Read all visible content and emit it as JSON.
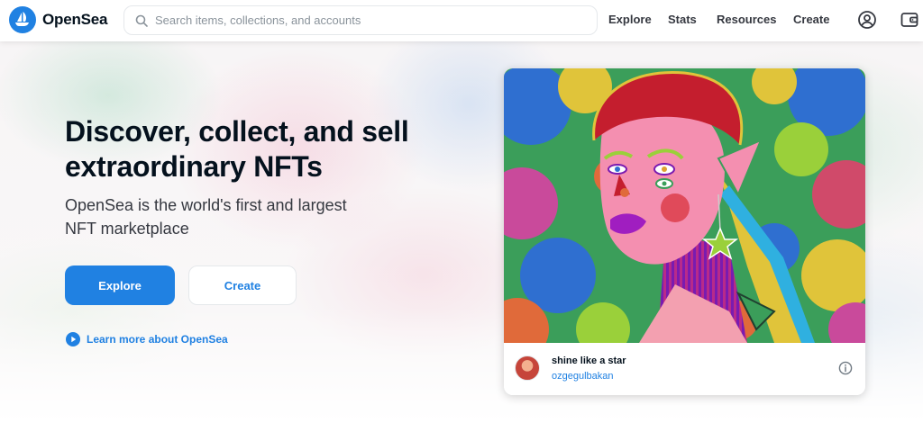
{
  "header": {
    "brand": "OpenSea",
    "search": {
      "placeholder": "Search items, collections, and accounts",
      "value": ""
    },
    "nav": [
      {
        "label": "Explore"
      },
      {
        "label": "Stats"
      },
      {
        "label": "Resources"
      },
      {
        "label": "Create"
      }
    ],
    "icons": [
      "opensea-logo-icon",
      "search-icon",
      "account-icon",
      "wallet-icon"
    ]
  },
  "hero": {
    "headline": "Discover, collect, and sell extraordinary NFTs",
    "subhead": "OpenSea is the world's first and largest NFT marketplace",
    "explore_button": "Explore",
    "create_button": "Create",
    "learn_more": "Learn more about OpenSea"
  },
  "featured": {
    "title": "shine like a star",
    "creator": "ozgegulbakan",
    "icons": [
      "creator-avatar",
      "info-icon"
    ]
  },
  "colors": {
    "accent": "#2081e2",
    "text_primary": "#04111d",
    "text_secondary": "#353840",
    "border": "#e5e8eb"
  }
}
